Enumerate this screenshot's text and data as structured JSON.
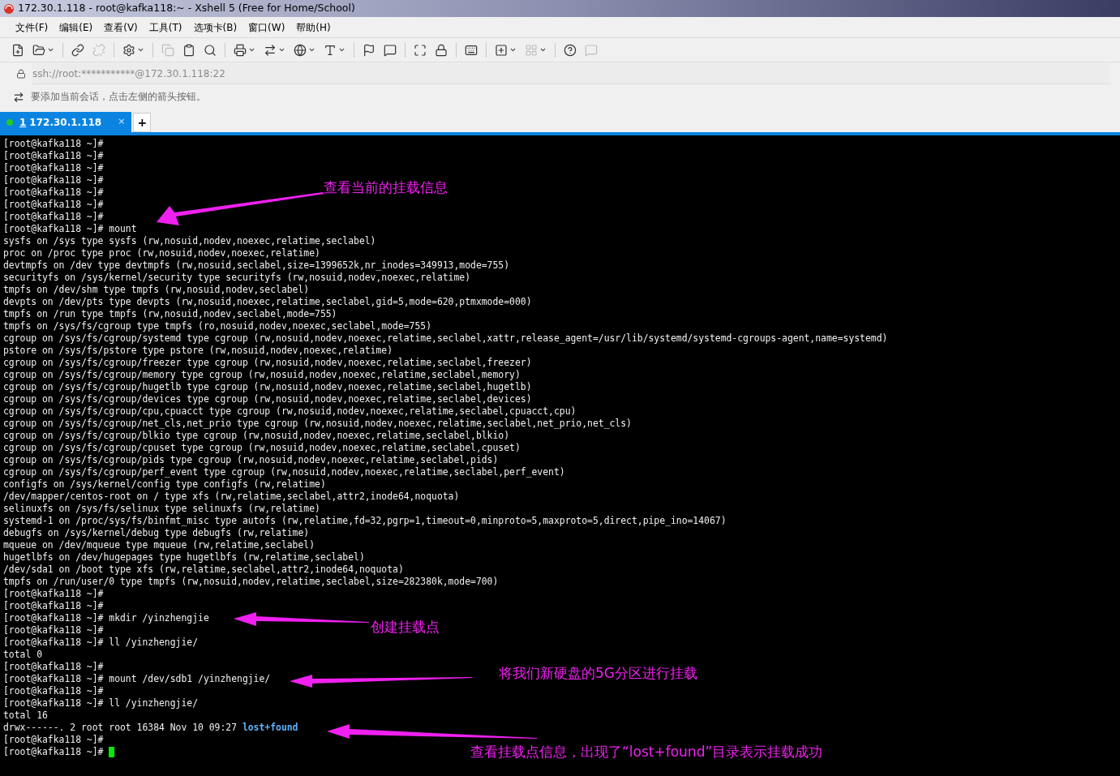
{
  "window": {
    "title": "172.30.1.118 - root@kafka118:~ - Xshell 5 (Free for Home/School)"
  },
  "menu": [
    "文件(F)",
    "编辑(E)",
    "查看(V)",
    "工具(T)",
    "选项卡(B)",
    "窗口(W)",
    "帮助(H)"
  ],
  "address_bar": {
    "value": "ssh://root:***********@172.30.1.118:22"
  },
  "info_bar": {
    "text": "要添加当前会话，点击左侧的箭头按钮。"
  },
  "tabs": [
    {
      "index": "1",
      "label": "172.30.1.118",
      "selected": true,
      "connected": true,
      "close": "×"
    }
  ],
  "new_tab": "+",
  "terminal": {
    "lines": [
      {
        "text": "[root@kafka118 ~]#"
      },
      {
        "text": "[root@kafka118 ~]#"
      },
      {
        "text": "[root@kafka118 ~]#"
      },
      {
        "text": "[root@kafka118 ~]#"
      },
      {
        "text": "[root@kafka118 ~]#"
      },
      {
        "text": "[root@kafka118 ~]#"
      },
      {
        "text": "[root@kafka118 ~]#"
      },
      {
        "text": "[root@kafka118 ~]# mount"
      },
      {
        "text": "sysfs on /sys type sysfs (rw,nosuid,nodev,noexec,relatime,seclabel)"
      },
      {
        "text": "proc on /proc type proc (rw,nosuid,nodev,noexec,relatime)"
      },
      {
        "text": "devtmpfs on /dev type devtmpfs (rw,nosuid,seclabel,size=1399652k,nr_inodes=349913,mode=755)"
      },
      {
        "text": "securityfs on /sys/kernel/security type securityfs (rw,nosuid,nodev,noexec,relatime)"
      },
      {
        "text": "tmpfs on /dev/shm type tmpfs (rw,nosuid,nodev,seclabel)"
      },
      {
        "text": "devpts on /dev/pts type devpts (rw,nosuid,noexec,relatime,seclabel,gid=5,mode=620,ptmxmode=000)"
      },
      {
        "text": "tmpfs on /run type tmpfs (rw,nosuid,nodev,seclabel,mode=755)"
      },
      {
        "text": "tmpfs on /sys/fs/cgroup type tmpfs (ro,nosuid,nodev,noexec,seclabel,mode=755)"
      },
      {
        "text": "cgroup on /sys/fs/cgroup/systemd type cgroup (rw,nosuid,nodev,noexec,relatime,seclabel,xattr,release_agent=/usr/lib/systemd/systemd-cgroups-agent,name=systemd)"
      },
      {
        "text": "pstore on /sys/fs/pstore type pstore (rw,nosuid,nodev,noexec,relatime)"
      },
      {
        "text": "cgroup on /sys/fs/cgroup/freezer type cgroup (rw,nosuid,nodev,noexec,relatime,seclabel,freezer)"
      },
      {
        "text": "cgroup on /sys/fs/cgroup/memory type cgroup (rw,nosuid,nodev,noexec,relatime,seclabel,memory)"
      },
      {
        "text": "cgroup on /sys/fs/cgroup/hugetlb type cgroup (rw,nosuid,nodev,noexec,relatime,seclabel,hugetlb)"
      },
      {
        "text": "cgroup on /sys/fs/cgroup/devices type cgroup (rw,nosuid,nodev,noexec,relatime,seclabel,devices)"
      },
      {
        "text": "cgroup on /sys/fs/cgroup/cpu,cpuacct type cgroup (rw,nosuid,nodev,noexec,relatime,seclabel,cpuacct,cpu)"
      },
      {
        "text": "cgroup on /sys/fs/cgroup/net_cls,net_prio type cgroup (rw,nosuid,nodev,noexec,relatime,seclabel,net_prio,net_cls)"
      },
      {
        "text": "cgroup on /sys/fs/cgroup/blkio type cgroup (rw,nosuid,nodev,noexec,relatime,seclabel,blkio)"
      },
      {
        "text": "cgroup on /sys/fs/cgroup/cpuset type cgroup (rw,nosuid,nodev,noexec,relatime,seclabel,cpuset)"
      },
      {
        "text": "cgroup on /sys/fs/cgroup/pids type cgroup (rw,nosuid,nodev,noexec,relatime,seclabel,pids)"
      },
      {
        "text": "cgroup on /sys/fs/cgroup/perf_event type cgroup (rw,nosuid,nodev,noexec,relatime,seclabel,perf_event)"
      },
      {
        "text": "configfs on /sys/kernel/config type configfs (rw,relatime)"
      },
      {
        "text": "/dev/mapper/centos-root on / type xfs (rw,relatime,seclabel,attr2,inode64,noquota)"
      },
      {
        "text": "selinuxfs on /sys/fs/selinux type selinuxfs (rw,relatime)"
      },
      {
        "text": "systemd-1 on /proc/sys/fs/binfmt_misc type autofs (rw,relatime,fd=32,pgrp=1,timeout=0,minproto=5,maxproto=5,direct,pipe_ino=14067)"
      },
      {
        "text": "debugfs on /sys/kernel/debug type debugfs (rw,relatime)"
      },
      {
        "text": "mqueue on /dev/mqueue type mqueue (rw,relatime,seclabel)"
      },
      {
        "text": "hugetlbfs on /dev/hugepages type hugetlbfs (rw,relatime,seclabel)"
      },
      {
        "text": "/dev/sda1 on /boot type xfs (rw,relatime,seclabel,attr2,inode64,noquota)"
      },
      {
        "text": "tmpfs on /run/user/0 type tmpfs (rw,nosuid,nodev,relatime,seclabel,size=282380k,mode=700)"
      },
      {
        "text": "[root@kafka118 ~]#"
      },
      {
        "text": "[root@kafka118 ~]#"
      },
      {
        "text": "[root@kafka118 ~]# mkdir /yinzhengjie"
      },
      {
        "text": "[root@kafka118 ~]#"
      },
      {
        "text": "[root@kafka118 ~]# ll /yinzhengjie/"
      },
      {
        "text": "total 0"
      },
      {
        "text": "[root@kafka118 ~]#"
      },
      {
        "text": "[root@kafka118 ~]# mount /dev/sdb1 /yinzhengjie/"
      },
      {
        "text": "[root@kafka118 ~]#"
      },
      {
        "text": "[root@kafka118 ~]# ll /yinzhengjie/"
      },
      {
        "text": "total 16"
      },
      {
        "text": "drwx------. 2 root root 16384 Nov 10 09:27 ",
        "highlight": "lost+found"
      },
      {
        "text": "[root@kafka118 ~]#"
      },
      {
        "text": "[root@kafka118 ~]# ",
        "cursor": true
      }
    ]
  },
  "annotations": [
    {
      "text": "查看当前的挂载信息"
    },
    {
      "text": "创建挂载点"
    },
    {
      "text": "将我们新硬盘的5G分区进行挂载"
    },
    {
      "text": "查看挂载点信息，出现了“lost+found”目录表示挂载成功"
    }
  ]
}
